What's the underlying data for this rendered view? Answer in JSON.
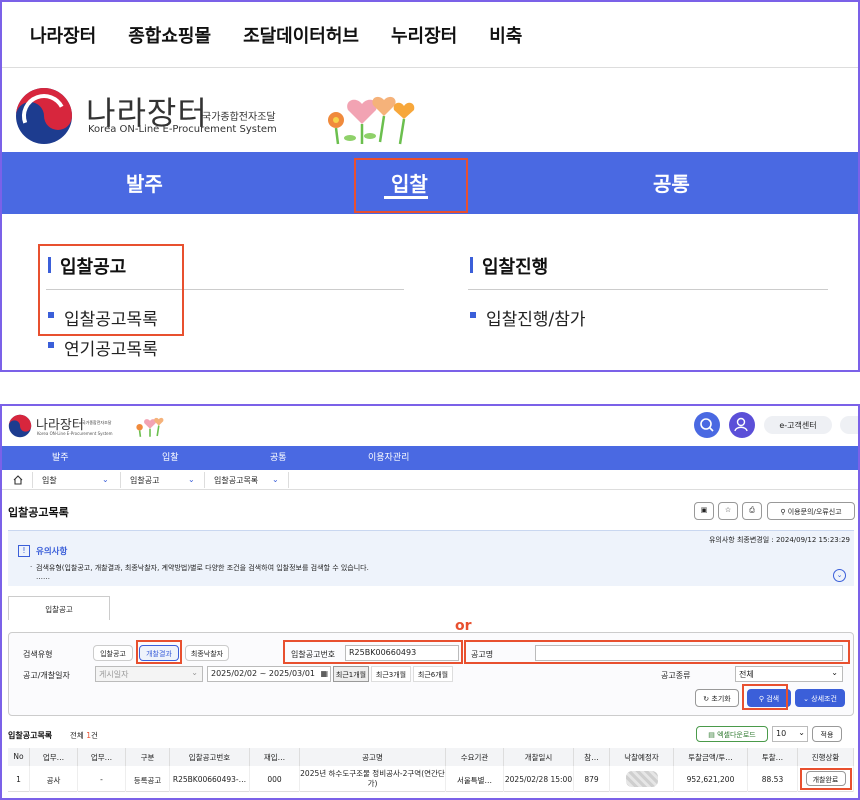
{
  "top_panel": {
    "top_nav": [
      "나라장터",
      "종합쇼핑몰",
      "조달데이터허브",
      "누리장터",
      "비축"
    ],
    "logo_title": "나라장터",
    "logo_subtitle_kr": "국가종합전자조달",
    "logo_subtitle_en": "Korea ON-Line E-Procurement System",
    "main_tabs": [
      "발주",
      "입찰",
      "공통"
    ],
    "section_left_title": "입찰공고",
    "section_left_links": [
      "입찰공고목록",
      "연기공고목록"
    ],
    "section_right_title": "입찰진행",
    "section_right_links": [
      "입찰진행/참가"
    ]
  },
  "bottom_panel": {
    "logo_title": "나라장터",
    "logo_subtitle_kr": "국가종합전자조달",
    "logo_subtitle_en": "Korea ON-Line E-Procurement System",
    "customer_center": "e-고객센터",
    "nav": [
      "발주",
      "입찰",
      "공통",
      "이용자관리"
    ],
    "breadcrumb": [
      "입찰",
      "입찰공고",
      "입찰공고목록"
    ],
    "page_title": "입찰공고목록",
    "inquiry_button": "이용문의/오류신고",
    "notice_date": "유의사항 최종변경일 : 2024/09/12 15:23:29",
    "notice_title": "유의사항",
    "notice_text": "검색유형(입찰공고, 개찰결과, 최종낙찰자, 계약방법)별로 다양한 조건을 검색하여 입찰정보를 검색할 수 있습니다.",
    "notice_more": "……",
    "tab_label": "입찰공고",
    "or_label": "or",
    "search": {
      "type_label": "검색유형",
      "types": [
        "입찰공고",
        "개찰결과",
        "최종낙찰자"
      ],
      "bid_no_label": "입찰공고번호",
      "bid_no_value": "R25BK00660493",
      "notice_name_label": "공고명",
      "notice_name_value": "",
      "date_label": "공고/개찰일자",
      "date_select": "게시일자",
      "date_from": "2025/02/02",
      "date_sep": "~",
      "date_to": "2025/03/01",
      "periods": [
        "최근1개월",
        "최근3개월",
        "최근6개월"
      ],
      "kind_label": "공고종류",
      "kind_value": "전체",
      "reset": "초기화",
      "search": "검색",
      "detail": "상세조건"
    },
    "results": {
      "title": "입찰공고목록",
      "total_prefix": "전체",
      "total_count": "1",
      "total_suffix": "건",
      "excel": "엑셀다운로드",
      "page_size": "10",
      "apply": "적용"
    },
    "table_headers": [
      "No",
      "업무…",
      "업무…",
      "구분",
      "입찰공고번호",
      "재입…",
      "공고명",
      "수요기관",
      "개찰일시",
      "참…",
      "낙찰예정자",
      "투찰금액/투…",
      "투찰…",
      "진행상황"
    ],
    "table_row": [
      "1",
      "공사",
      "-",
      "등록공고",
      "R25BK00660493-…",
      "000",
      "2025년 하수도구조물 정비공사-2구역(연간단가)",
      "서울특별…",
      "2025/02/28 15:00",
      "879",
      "",
      "952,621,200",
      "88.53",
      "개찰완료"
    ]
  },
  "colors": {
    "accent": "#4a69e2",
    "highlight": "#e8502f",
    "frame": "#7b61e8"
  }
}
